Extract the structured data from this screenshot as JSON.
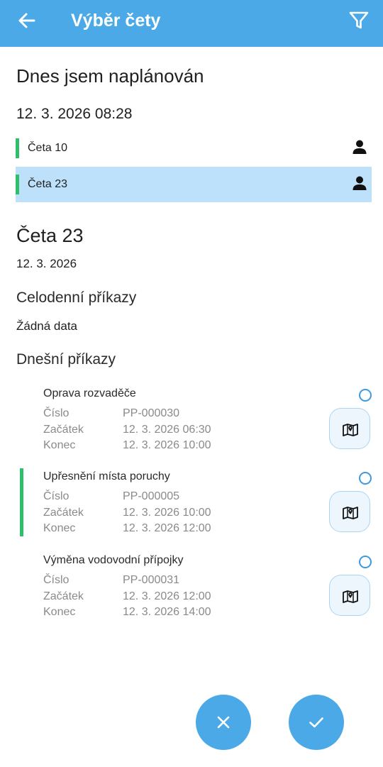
{
  "appbar": {
    "title": "Výběr čety",
    "back_icon": "arrow-left-icon",
    "filter_icon": "filter-icon",
    "color": "#4aa9e6"
  },
  "schedule": {
    "heading": "Dnes jsem naplánován",
    "datetime": "12. 3. 2026 08:28",
    "crews": [
      {
        "label": "Četa 10",
        "selected": false
      },
      {
        "label": "Četa 23",
        "selected": true
      }
    ]
  },
  "detail": {
    "crew_title": "Četa 23",
    "date": "12. 3. 2026",
    "allday_heading": "Celodenní příkazy",
    "allday_empty": "Žádná data",
    "today_heading": "Dnešní příkazy",
    "orders": [
      {
        "title": "Oprava rozvaděče",
        "number_label": "Číslo",
        "number": "PP-000030",
        "start_label": "Začátek",
        "start": "12. 3. 2026 06:30",
        "end_label": "Konec",
        "end": "12. 3. 2026 10:00",
        "highlighted": false
      },
      {
        "title": "Upřesnění místa poruchy",
        "number_label": "Číslo",
        "number": "PP-000005",
        "start_label": "Začátek",
        "start": "12. 3. 2026 10:00",
        "end_label": "Konec",
        "end": "12. 3. 2026 12:00",
        "highlighted": true
      },
      {
        "title": "Výměna vodovodní přípojky",
        "number_label": "Číslo",
        "number": "PP-000031",
        "start_label": "Začátek",
        "start": "12. 3. 2026 12:00",
        "end_label": "Konec",
        "end": "12. 3. 2026 14:00",
        "highlighted": false
      }
    ]
  },
  "actions": {
    "cancel_icon": "close-icon",
    "confirm_icon": "check-icon"
  },
  "colors": {
    "accent": "#4aa9e6",
    "selected_row": "#bde0fb",
    "status_green": "#2fbf6b"
  }
}
